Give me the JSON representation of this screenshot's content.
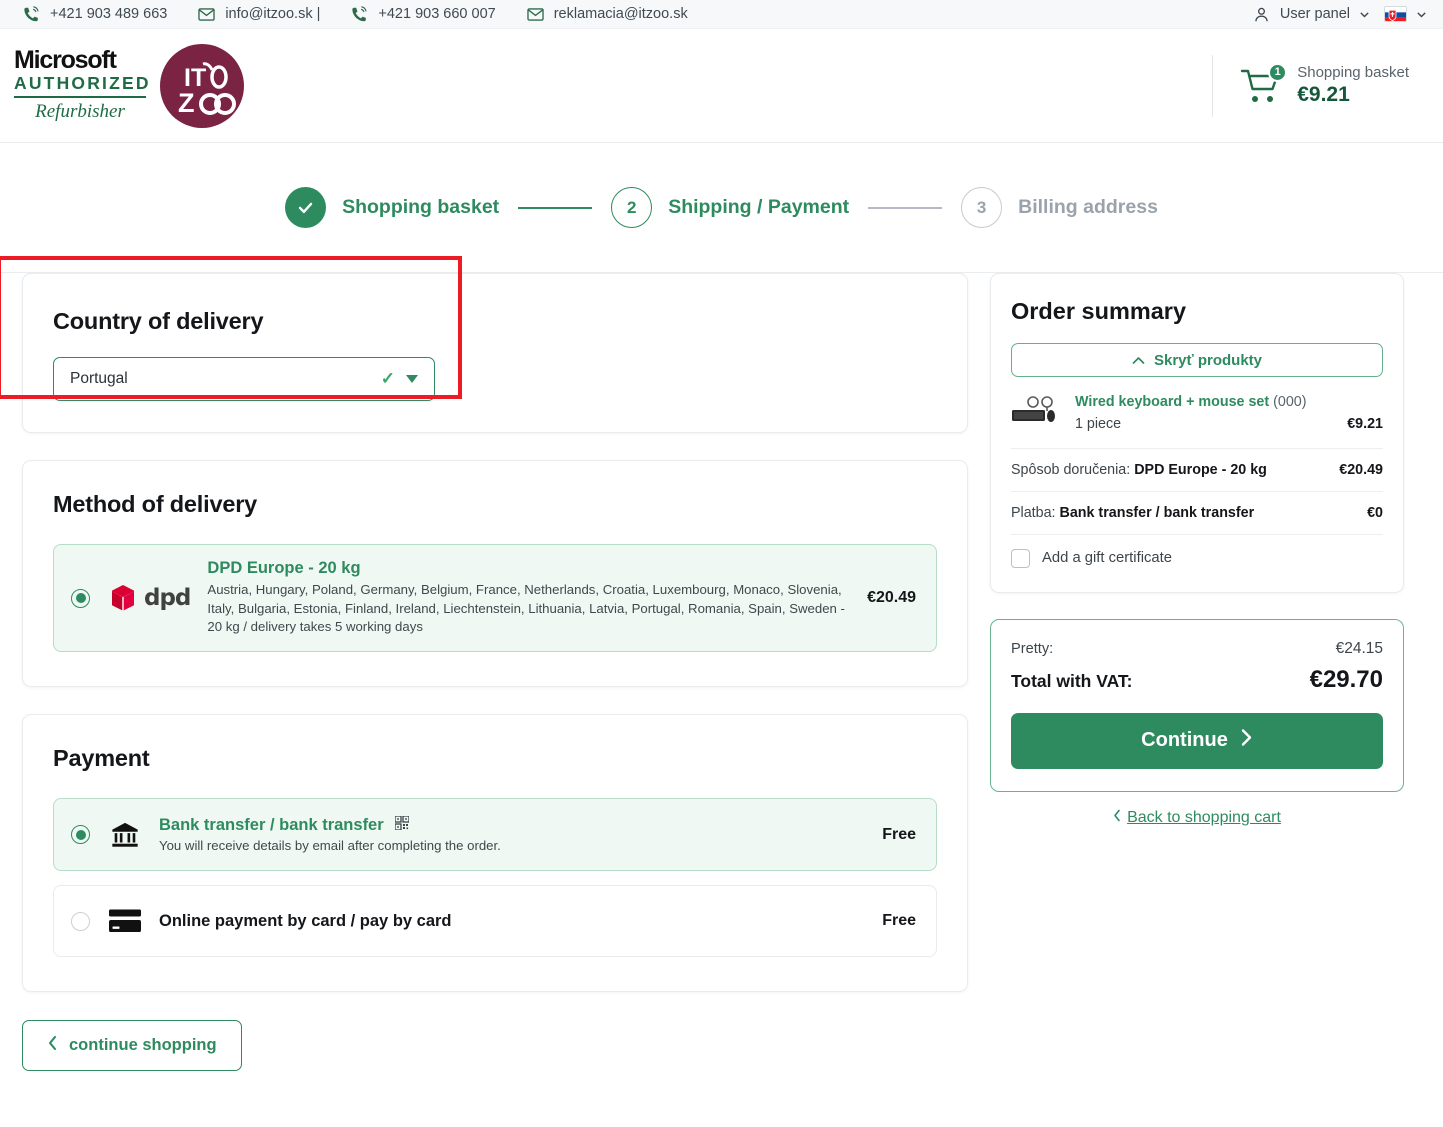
{
  "topbar": {
    "contacts": [
      {
        "icon": "phone-icon",
        "text": "+421 903 489 663"
      },
      {
        "icon": "mail-icon",
        "text": "info@itzoo.sk |"
      },
      {
        "icon": "phone-icon",
        "text": "+421 903 660 007"
      },
      {
        "icon": "mail-icon",
        "text": "reklamacia@itzoo.sk"
      }
    ],
    "user_panel_label": "User panel",
    "language": "sk"
  },
  "header": {
    "logo": {
      "microsoft": "Microsoft",
      "authorized": "AUTHORIZED",
      "refurbisher": "Refurbisher",
      "brand_it": "IT",
      "brand_zoo": "Zoo"
    },
    "basket": {
      "count": "1",
      "label": "Shopping basket",
      "price": "€9.21"
    }
  },
  "stepper": {
    "steps": [
      {
        "marker": "✓",
        "label": "Shopping basket",
        "state": "done"
      },
      {
        "marker": "2",
        "label": "Shipping / Payment",
        "state": "active"
      },
      {
        "marker": "3",
        "label": "Billing address",
        "state": "todo"
      }
    ]
  },
  "country": {
    "title": "Country of delivery",
    "selected": "Portugal"
  },
  "delivery": {
    "title": "Method of delivery",
    "options": [
      {
        "carrier": "dpd",
        "name": "DPD Europe - 20 kg",
        "desc": "Austria, Hungary, Poland, Germany, Belgium, France, Netherlands, Croatia, Luxembourg, Monaco, Slovenia, Italy, Bulgaria, Estonia, Finland, Ireland, Liechtenstein, Lithuania, Latvia, Portugal, Romania, Spain, Sweden - 20 kg / delivery takes 5 working days",
        "price": "€20.49",
        "selected": true
      }
    ]
  },
  "payment": {
    "title": "Payment",
    "options": [
      {
        "icon": "bank-icon",
        "name": "Bank transfer / bank transfer",
        "badge_icon": "qr-code-icon",
        "desc": "You will receive details by email after completing the order.",
        "price": "Free",
        "selected": true
      },
      {
        "icon": "credit-card-icon",
        "name": "Online payment by card / pay by card",
        "desc": "",
        "price": "Free",
        "selected": false
      }
    ]
  },
  "continue_shopping_label": "continue shopping",
  "summary": {
    "title": "Order summary",
    "hide_products_label": "Skryť produkty",
    "product": {
      "name": "Wired keyboard + mouse set",
      "code": "(000)",
      "qty": "1 piece",
      "price": "€9.21"
    },
    "lines": [
      {
        "label": "Spôsob doručenia:",
        "value": "DPD Europe - 20 kg",
        "price": "€20.49"
      },
      {
        "label": "Platba:",
        "value": "Bank transfer / bank transfer",
        "price": "€0"
      }
    ],
    "gift_certificate_label": "Add a gift certificate"
  },
  "totals": {
    "pretty_label": "Pretty:",
    "pretty_value": "€24.15",
    "total_label": "Total with VAT:",
    "total_value": "€29.70",
    "continue_label": "Continue",
    "back_label": "Back to shopping cart"
  },
  "colors": {
    "accent_green": "#2e8b5f",
    "dark_green": "#14573a",
    "highlight_red": "#ed1c24",
    "dpd_red": "#dc0032",
    "brand_maroon": "#7a2342"
  }
}
